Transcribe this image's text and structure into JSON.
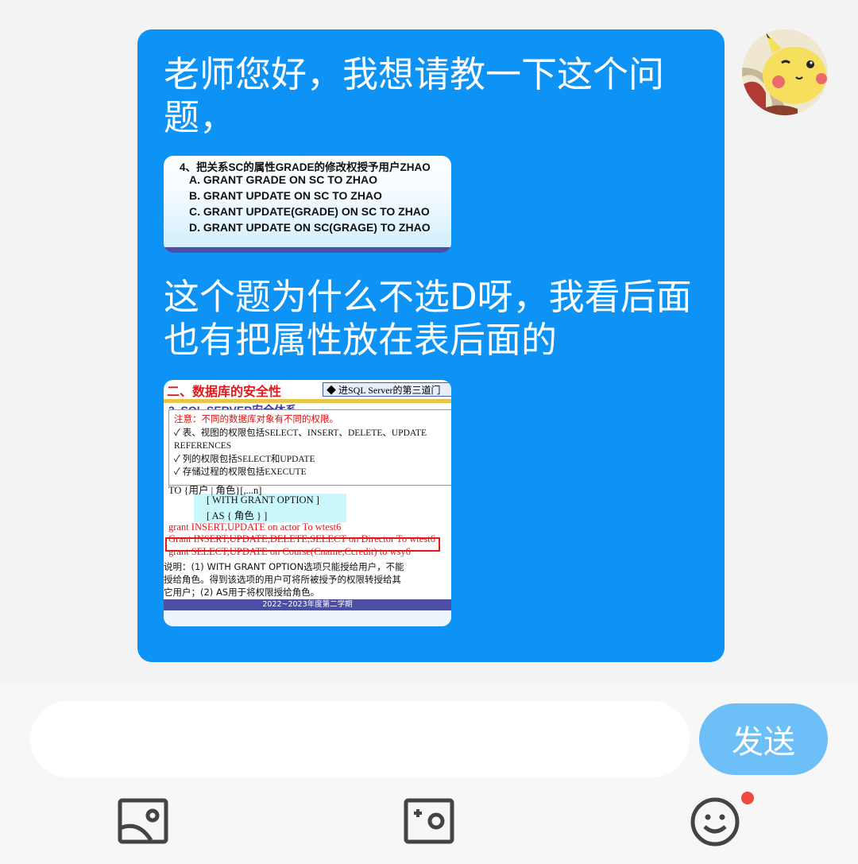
{
  "message": {
    "text_line1": "老师您好，我想请教一下这个问题，",
    "text_line2": "这个题为什么不选D呀，我看后面也有把属性放在表后面的"
  },
  "slide1": {
    "question": "4、把关系SC的属性GRADE的修改权授予用户ZHAO",
    "options": [
      "A.  GRANT GRADE ON SC TO ZHAO",
      "B.  GRANT UPDATE ON SC TO ZHAO",
      "C.  GRANT UPDATE(GRADE) ON SC TO ZHAO",
      "D.  GRANT UPDATE ON SC(GRAGE) TO ZHAO"
    ]
  },
  "slide2": {
    "title": "二、数据库的安全性",
    "nav_box": "◆ 进SQL Server的第三道门",
    "subtitle": "3. SQL SERVER安全体系",
    "note_title": "注意：不同的数据库对象有不同的权限。",
    "note_items": [
      "✓  表、视图的权限包括SELECT、INSERT、DELETE、UPDATE",
      "     REFERENCES",
      "✓  列的权限包括SELECT和UPDATE",
      "✓  存储过程的权限包括EXECUTE"
    ],
    "syntax": [
      "TO     {用户 | 角色}[,...n]",
      "[ WITH GRANT OPTION ]",
      "[ AS { 角色 } ]"
    ],
    "examples": [
      "grant INSERT,UPDATE on actor To wtest6",
      "Grant INSERT,UPDATE,DELETE,SELECT on Director To wtest6",
      "grant SELECT,UPDATE on Course(Cname,Ccredit) to wsy6"
    ],
    "explain": [
      "说明：(1) WITH GRANT OPTION选项只能授给用户，不能",
      "授给角色。得到该选项的用户可将所被授予的权限转授给其",
      "它用户；(2) AS用于将权限授给角色。"
    ],
    "footer": "2022~2023年度第二学期"
  },
  "input": {
    "value": "",
    "placeholder": ""
  },
  "send_label": "发送",
  "toolbar_icons": [
    "image-icon",
    "camera-icon",
    "emoji-icon"
  ],
  "colors": {
    "bubble": "#0c93f5",
    "send": "#6cc0f7",
    "badge": "#f0473e"
  }
}
